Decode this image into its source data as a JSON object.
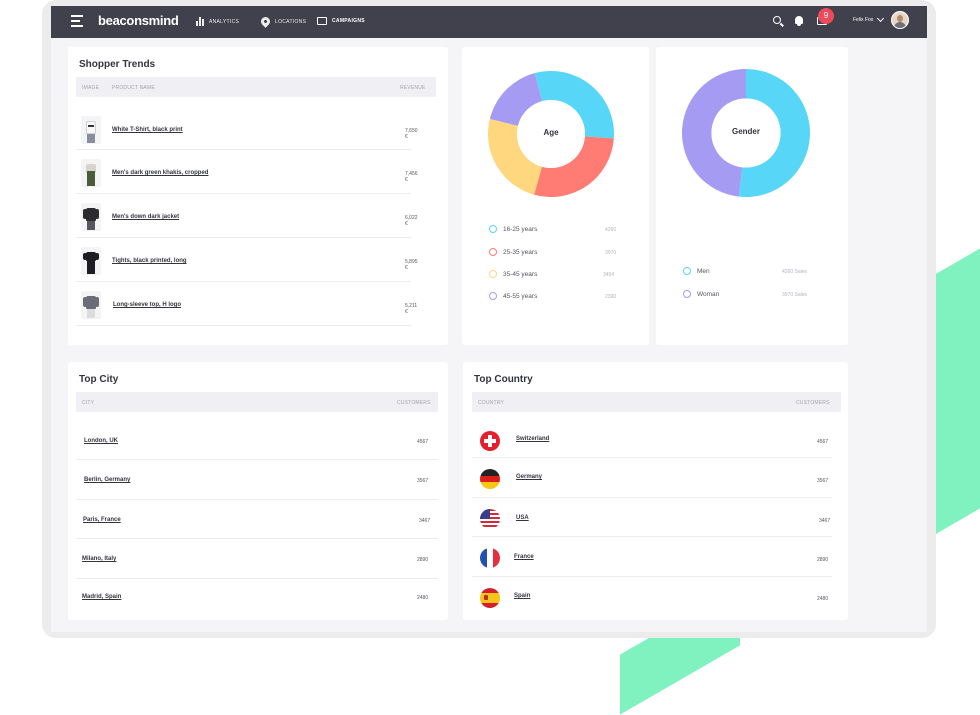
{
  "colors": {
    "cyan": "#57d6f7",
    "red": "#fe7c73",
    "yellow": "#fed77f",
    "purple": "#a59bf3",
    "topbar": "#41414d",
    "badge": "#ee4a5e",
    "accent_bg": "#7ff2c0"
  },
  "topbar": {
    "logo": "beaconsmind",
    "nav": [
      {
        "label": "ANALYTICS",
        "icon": "bar-chart-icon"
      },
      {
        "label": "LOCATIONS",
        "icon": "location-pin-icon"
      },
      {
        "label": "CAMPAIGNS",
        "icon": "screen-icon"
      }
    ],
    "notification_count": "9",
    "user_name": "Felix Fox"
  },
  "shopper_trends": {
    "title": "Shopper Trends",
    "columns": {
      "image": "IMAGE",
      "product": "PRODUCT NAME",
      "revenue": "REVENUE"
    },
    "rows": [
      {
        "name": "White T-Shirt, black print",
        "revenue": "7,650 €",
        "icon": "white-tshirt-thumb"
      },
      {
        "name": "Men's dark green khakis, cropped",
        "revenue": "7,456 €",
        "icon": "khakis-thumb"
      },
      {
        "name": "Men's down dark jacket",
        "revenue": "6,022 €",
        "icon": "jacket-thumb"
      },
      {
        "name": "Tights, black printed, long",
        "revenue": "5,895 €",
        "icon": "tights-thumb"
      },
      {
        "name": "Long-sleeve top, H logo",
        "revenue": "5,211 €",
        "icon": "longsleeve-thumb"
      }
    ]
  },
  "age": {
    "center_label": "Age",
    "segments": [
      {
        "label": "16-25 years",
        "value": 4260
      },
      {
        "label": "25-35 years",
        "value": 3970
      },
      {
        "label": "35-45 years",
        "value": 3454
      },
      {
        "label": "45-55 years",
        "value": 2390
      }
    ]
  },
  "gender": {
    "center_label": "Gender",
    "segments": [
      {
        "label": "Men",
        "value_text": "4260 Sales",
        "value": 4260
      },
      {
        "label": "Woman",
        "value_text": "3970 Sales",
        "value": 3970
      }
    ]
  },
  "top_city": {
    "title": "Top City",
    "columns": {
      "city": "CITY",
      "customers": "CUSTOMERS"
    },
    "rows": [
      {
        "name": "London, UK",
        "customers": "4567"
      },
      {
        "name": "Berlin, Germany",
        "customers": "3567"
      },
      {
        "name": "Paris, France",
        "customers": "3467"
      },
      {
        "name": "Milano, Italy",
        "customers": "2890"
      },
      {
        "name": "Madrid, Spain",
        "customers": "2480"
      }
    ]
  },
  "top_country": {
    "title": "Top Country",
    "columns": {
      "country": "COUNTRY",
      "customers": "CUSTOMERS"
    },
    "rows": [
      {
        "name": "Switzerland",
        "customers": "4567",
        "icon": "swiss-flag-icon"
      },
      {
        "name": "Germany",
        "customers": "3567",
        "icon": "german-flag-icon"
      },
      {
        "name": "USA",
        "customers": "3467",
        "icon": "usa-flag-icon"
      },
      {
        "name": "France",
        "customers": "2890",
        "icon": "french-flag-icon"
      },
      {
        "name": "Spain",
        "customers": "2480",
        "icon": "spanish-flag-icon"
      }
    ]
  }
}
